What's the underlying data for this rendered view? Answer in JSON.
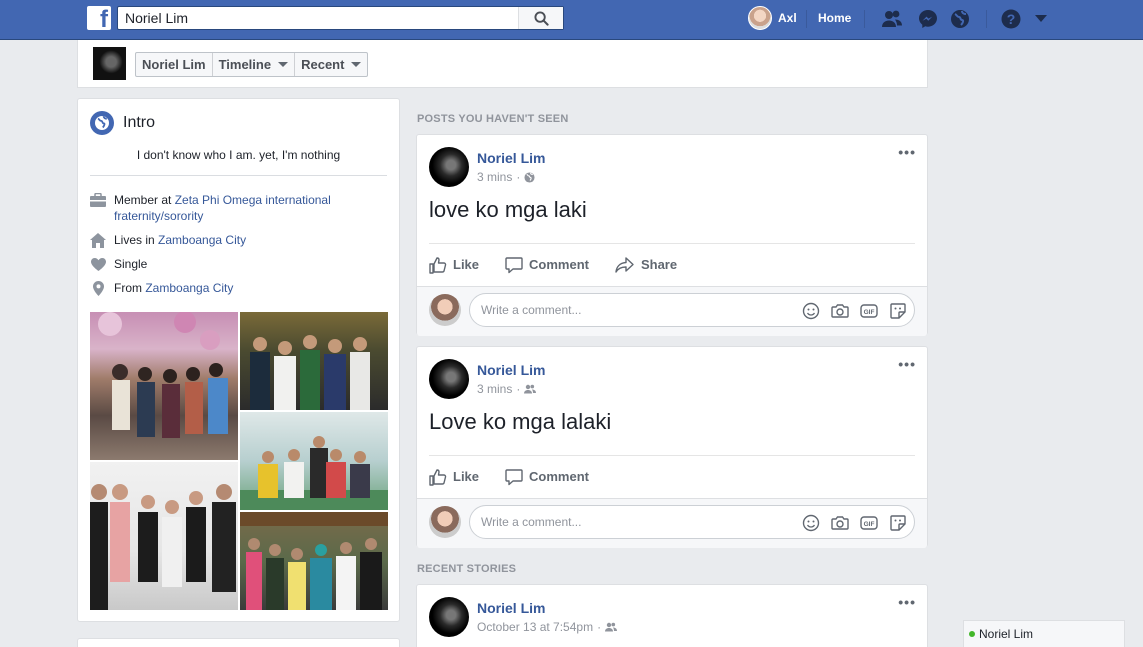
{
  "topbar": {
    "search_value": "Noriel Lim",
    "user_name": "Axl",
    "home_label": "Home",
    "logo_letter": "f"
  },
  "profile_nav": {
    "name": "Noriel Lim",
    "timeline_label": "Timeline",
    "recent_label": "Recent"
  },
  "intro": {
    "title": "Intro",
    "bio": "I don't know who I am. yet, I'm nothing",
    "member_prefix": "Member at ",
    "member_org": "Zeta Phi Omega international fraternity/sorority",
    "lives_prefix": "Lives in ",
    "lives_city": "Zamboanga City",
    "relationship": "Single",
    "from_prefix": "From ",
    "from_city": "Zamboanga City"
  },
  "feed": {
    "unseen_label": "POSTS YOU HAVEN'T SEEN",
    "recent_label": "RECENT STORIES",
    "comment_placeholder": "Write a comment...",
    "like_label": "Like",
    "comment_label": "Comment",
    "share_label": "Share",
    "posts": [
      {
        "author": "Noriel Lim",
        "time": "3 mins",
        "audience": "public-globe-icon",
        "text": "love ko mga laki"
      },
      {
        "author": "Noriel Lim",
        "time": "3 mins",
        "audience": "friends-icon",
        "text": "Love ko mga lalaki"
      },
      {
        "author": "Noriel Lim",
        "time": "October 13 at 7:54pm",
        "audience": "friends-icon",
        "text": ""
      }
    ]
  },
  "chat": {
    "contact": "Noriel Lim",
    "status_color": "#42b72a"
  },
  "colors": {
    "brand": "#4267b2",
    "link": "#365899",
    "background": "#e9ebee"
  }
}
